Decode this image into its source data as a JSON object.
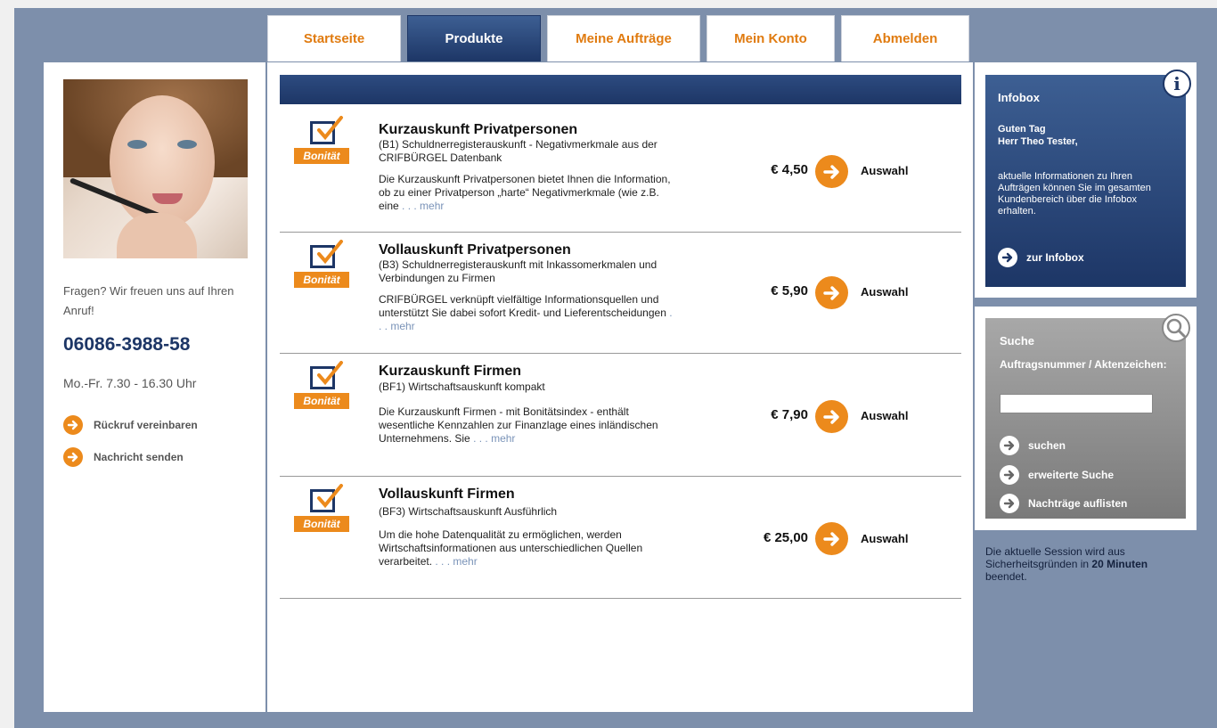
{
  "nav": {
    "tabs": [
      {
        "label": "Startseite"
      },
      {
        "label": "Produkte"
      },
      {
        "label": "Meine Aufträge"
      },
      {
        "label": "Mein Konto"
      },
      {
        "label": "Abmelden"
      }
    ]
  },
  "contact": {
    "question": "Fragen? Wir freuen uns auf Ihren Anruf!",
    "phone": "06086-3988-58",
    "hours": "Mo.-Fr. 7.30 - 16.30 Uhr",
    "callback_label": "Rückruf vereinbaren",
    "message_label": "Nachricht senden"
  },
  "products": [
    {
      "badge": "Bonität",
      "title": "Kurzauskunft Privatpersonen",
      "subtitle": "(B1) Schuldnerregisterauskunft - Negativmerkmale aus der CRIFBÜRGEL Datenbank",
      "description": "Die Kurzauskunft Privatpersonen bietet Ihnen die Information, ob zu einer Privatperson „harte“ Negativmerkmale (wie z.B. eine",
      "more": ". . . mehr",
      "price": "€ 4,50",
      "select": "Auswahl"
    },
    {
      "badge": "Bonität",
      "title": "Vollauskunft Privatpersonen",
      "subtitle": "(B3) Schuldnerregisterauskunft mit Inkassomerkmalen und Verbindungen zu Firmen",
      "description": "CRIFBÜRGEL verknüpft vielfältige Informationsquellen und unterstützt Sie dabei sofort Kredit- und Lieferentscheidungen",
      "more": ". . . mehr",
      "price": "€ 5,90",
      "select": "Auswahl"
    },
    {
      "badge": "Bonität",
      "title": "Kurzauskunft Firmen",
      "subtitle": "(BF1) Wirtschaftsauskunft kompakt",
      "description": "Die Kurzauskunft Firmen - mit Bonitätsindex - enthält wesentliche Kennzahlen zur Finanzlage eines inländischen Unternehmens. Sie",
      "more": ". . . mehr",
      "price": "€ 7,90",
      "select": "Auswahl"
    },
    {
      "badge": "Bonität",
      "title": "Vollauskunft Firmen",
      "subtitle": "(BF3) Wirtschaftsauskunft Ausführlich",
      "description": "Um die hohe Datenqualität zu ermöglichen, werden Wirtschaftsinformationen aus unterschiedlichen Quellen verarbeitet.",
      "more": ". . . mehr",
      "price": "€ 25,00",
      "select": "Auswahl"
    }
  ],
  "infobox": {
    "heading": "Infobox",
    "greeting_line1": "Guten Tag",
    "greeting_line2": "Herr Theo Tester,",
    "text": "aktuelle Informationen zu Ihren Aufträgen können Sie im gesamten Kundenbereich über die Infobox erhalten.",
    "link": "zur Infobox"
  },
  "search": {
    "heading": "Suche",
    "field_label": "Auftragsnummer / Aktenzeichen:",
    "value": "",
    "search_label": "suchen",
    "advanced_label": "erweiterte Suche",
    "list_label": "Nachträge auflisten"
  },
  "session": {
    "text_before": "Die aktuelle Session wird aus Sicherheitsgründen in",
    "minutes": "20 Minuten",
    "text_after": "beendet."
  },
  "colors": {
    "accent": "#ec8a1c",
    "navy": "#1d3666",
    "frame": "#7d8fab"
  }
}
